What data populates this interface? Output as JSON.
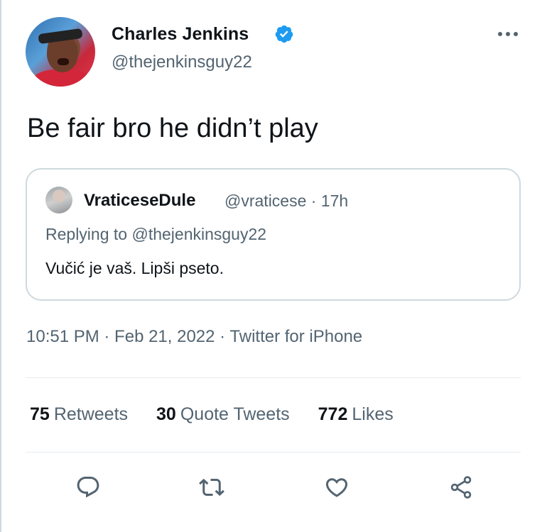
{
  "author": {
    "name": "Charles Jenkins",
    "handle": "@thejenkinsguy22",
    "verified": true
  },
  "tweet": {
    "text": "Be fair bro he didn’t play"
  },
  "quoted_tweet": {
    "name": "VraticeseDule",
    "handle_time": "@vraticese · 17h",
    "replying_label": "Replying to",
    "replying_to": "@thejenkinsguy22",
    "text": "Vučić je vaš. Lipši pseto."
  },
  "meta": {
    "time_line": "10:51 PM · Feb 21, 2022 · Twitter for iPhone"
  },
  "stats": {
    "retweets_count": "75",
    "retweets_label": "Retweets",
    "quotes_count": "30",
    "quotes_label": "Quote Tweets",
    "likes_count": "772",
    "likes_label": "Likes"
  },
  "actions": [
    "reply-icon",
    "retweet-icon",
    "like-icon",
    "share-icon"
  ],
  "colors": {
    "text": "#0f1419",
    "secondary": "#536471",
    "verified": "#1d9bf0",
    "border": "#cfd9de"
  }
}
